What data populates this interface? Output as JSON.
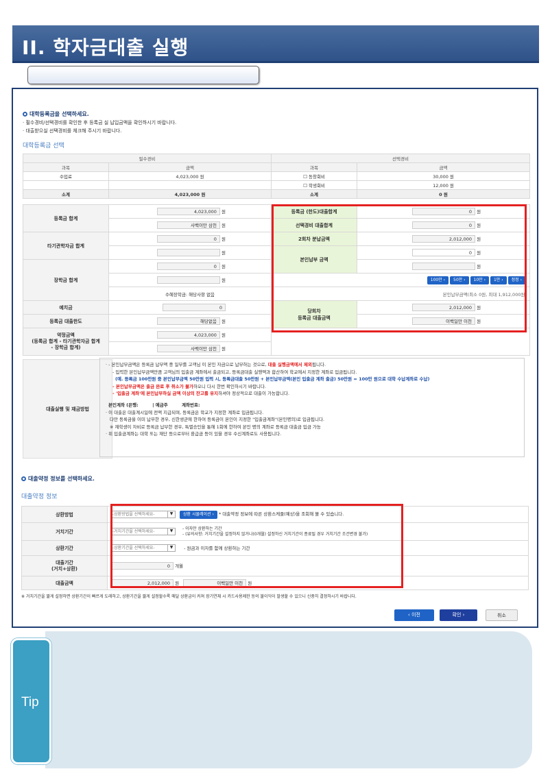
{
  "title": "II. 학자금대출 실행",
  "s1": {
    "head": "대학등록금을 선택하세요.",
    "n1": "· 필수경비/선택경비를 확인한 후 등록금 실 납입금액을 확인하시기 바랍니다.",
    "n2": "· 대출받으실 선택경비를 체크해 주시기 바랍니다.",
    "sub": "대학등록금 선택"
  },
  "fee": {
    "req": "필수경비",
    "opt": "선택경비",
    "c1": "과목",
    "c2": "금액",
    "r1n": "수업료",
    "r1v": "4,023,000 원",
    "o1": "동창회비",
    "o1v": "30,000 원",
    "o2": "학생회비",
    "o2v": "12,000 원",
    "sum": "소계",
    "sumv": "4,023,000 원",
    "sum2": "소계",
    "sum2v": "0 원"
  },
  "calc": {
    "reg": "등록금 합계",
    "reg_v1": "4,023,000",
    "won": "원",
    "reg_v2": "사백이만 삼천",
    "other": "타기관학자금 합계",
    "other_v": "0",
    "sch": "장학금 합계",
    "sch_v": "0",
    "sch_note": "수혜장학금: 해당사항 없음",
    "dep": "예치금",
    "dep_v": "0",
    "limit": "등록금 대출한도",
    "limit_v": "해당없음",
    "agreed": "약정금액\n(등록금 합계 - 타기관학자금 합계\n- 장학금 합계)",
    "agreed_v1": "4,023,000",
    "agreed_v2": "사백이만 삼천"
  },
  "right": {
    "l1": "등록금 (한도)대출합계",
    "v1": "0",
    "l2": "선택경비 대출합계",
    "v2": "0",
    "l3": "2회차 분납금액",
    "v3": "2,012,000",
    "l4": "본인납부 금액",
    "v4": "0",
    "btns": [
      "100만 ›",
      "50만 ›",
      "10만 ›",
      "1만 ›",
      "정정 ›"
    ],
    "range": "본인납부금액(최소 0원, 최대 1,912,000원)",
    "l5": "당회차\n등록금 대출금액",
    "v5": "2,012,000",
    "v6": "이백일만 이천"
  },
  "method": {
    "label": "대출실행 및 재금방법",
    "lines": [
      "· - 본인납부금액은 등록금 납부액 중 일부를 고객님 이 본인 자금으로 납부하는 것으로,",
      "대출 실행금액에서 제외",
      "됩니다.",
      "- 입력한 본인납부금액만큼 고객님의 입출금 계좌에서 출금되고, 등록금대출 실행액과 합산하여 학교에서 지정한 계좌로 입금됩니다.",
      "(예. 등록금 100만원 중 본인납부금액 50만원 입력 시, 등록금대출 50만원 + 본인납부금액(본인 입출금 계좌 출금) 50만원 = 100만 원으로 대학 수납계좌로 수납)",
      "- 본인납부금액은 출금 완료 후 취소가 불가",
      "하오니 다시 한번 확인하시기 바랍니다.",
      "- '입출금 계좌'에 본인납부하실 금액 이상의 잔고를 유지",
      "하셔야 정상적으로 대출이 가능합니다.",
      "본인계좌 (은행:",
      "| 예금주",
      "계좌번호:",
      "· 이 대출은 대출계시일에 전액 지급되며, 등록금은 학교가 지정한 계좌로 입금됩니다.",
      "다만 등록금을 이미 납부한 경우, 신한생군에 한하여 등록금이 본인이 지정한 \"입출금계좌\"(본인명의)로 입금됩니다.",
      "※ 재학생이 자비로 등록금 납부한 경우, 특별승인을 통해 1회에 한하여 본인 명의 계좌로 등록금 대출금 입금 가능",
      "· 위 입출금계좌는 대학 또는 재단 등으로부터 환급금 등이 있을 경우 수신계좌로도 사용됩니다."
    ]
  },
  "s2": {
    "head": "대출약정 정보를 선택하세요.",
    "sub": "대출약정 정보"
  },
  "loan": {
    "l1": "상환방법",
    "s1": "-상환방법을 선택하세요-",
    "b1": "상환 시뮬레이션 ›",
    "n1": "* 대출약정 정보에 따른 상환스케줄(예상)을 조회해 볼 수 있습니다.",
    "l2": "거치기간",
    "s2": "-거치기간을 선택하세요-",
    "n2a": "- 이자만 상환하는 기간",
    "n2b": "- (유의사항: 거치기간을 설정하지 않거나(0개월) 설정하신 거치기간이 종료될 경우 거치기간 조건변경 불가)",
    "l3": "상환기간",
    "s3": "-상환기간을 선택하세요-",
    "n3": "- 원금과 이자를 함께 상환하는 기간",
    "l4": "대출기간\n(거치+상환)",
    "v4": "0",
    "u4": "개월",
    "l5": "대출금액",
    "v5": "2,012,000",
    "u5": "원",
    "v5b": "이백일만 이천",
    "u5b": "원"
  },
  "warn": "※ 거치기간을 짧게 설정하면 상환기간이 빠르게 도래하고, 상환기간을 짧게 설정할수록 매달 상환금이 커져 장기연체 시 카드사용제한 등의 불이익이 발생할 수 있으니 신중히 결정하시기 바랍니다.",
  "actions": {
    "prev": "‹ 이전",
    "ok": "확인 ›",
    "cancel": "취소"
  },
  "tip": "Tip"
}
